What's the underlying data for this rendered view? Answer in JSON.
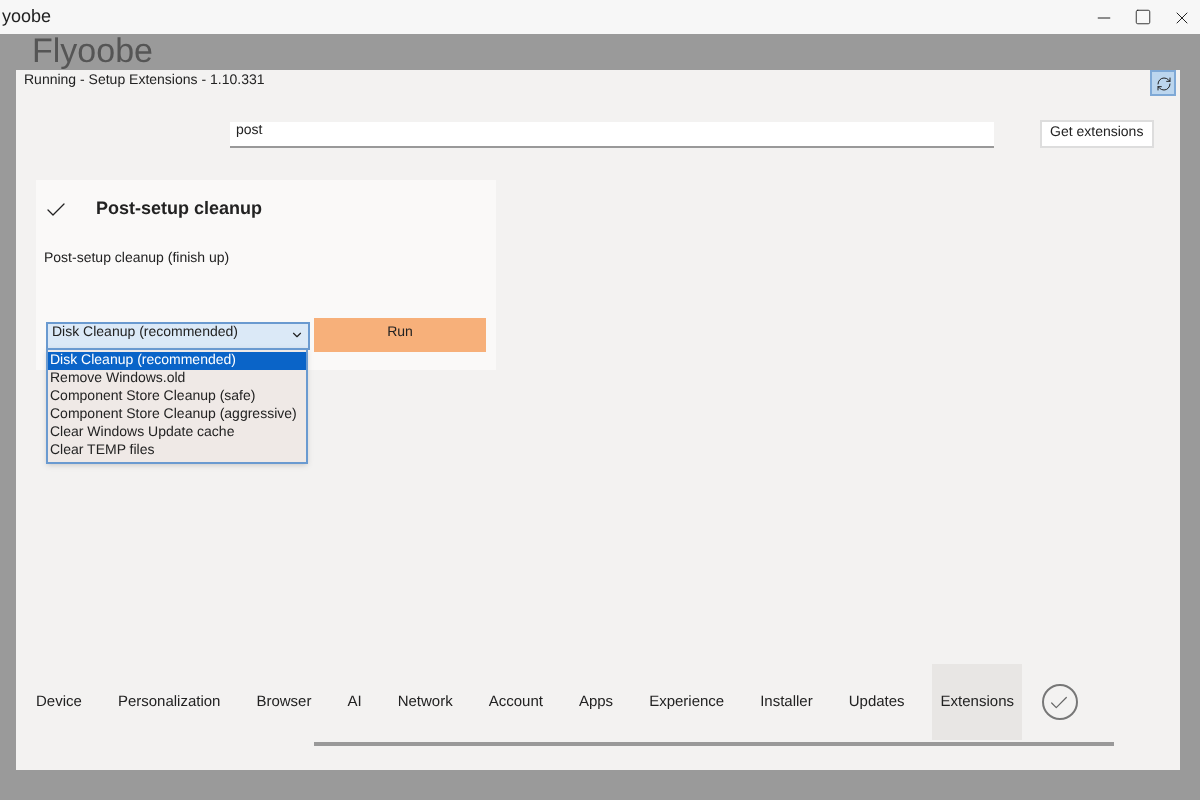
{
  "window": {
    "title": "yoobe"
  },
  "app_title": "Flyoobe",
  "dialog": {
    "title": "Running - Setup Extensions - 1.10.331"
  },
  "search": {
    "value": "post"
  },
  "get_extensions_button": "Get extensions",
  "extension": {
    "checked": true,
    "title": "Post-setup cleanup",
    "description": "Post-setup cleanup (finish up)",
    "select_value": "Disk Cleanup (recommended)",
    "run_button": "Run",
    "options": [
      {
        "label": "Disk Cleanup (recommended)",
        "selected": true
      },
      {
        "label": "Remove Windows.old",
        "selected": false
      },
      {
        "label": "Component Store Cleanup (safe)",
        "selected": false
      },
      {
        "label": "Component Store Cleanup (aggressive)",
        "selected": false
      },
      {
        "label": "Clear Windows Update cache",
        "selected": false
      },
      {
        "label": "Clear TEMP files",
        "selected": false
      }
    ]
  },
  "nav": [
    {
      "label": "Device",
      "selected": false
    },
    {
      "label": "Personalization",
      "selected": false
    },
    {
      "label": "Browser",
      "selected": false
    },
    {
      "label": "AI",
      "selected": false
    },
    {
      "label": "Network",
      "selected": false
    },
    {
      "label": "Account",
      "selected": false
    },
    {
      "label": "Apps",
      "selected": false
    },
    {
      "label": "Experience",
      "selected": false
    },
    {
      "label": "Installer",
      "selected": false
    },
    {
      "label": "Updates",
      "selected": false
    },
    {
      "label": "Extensions",
      "selected": true
    }
  ]
}
